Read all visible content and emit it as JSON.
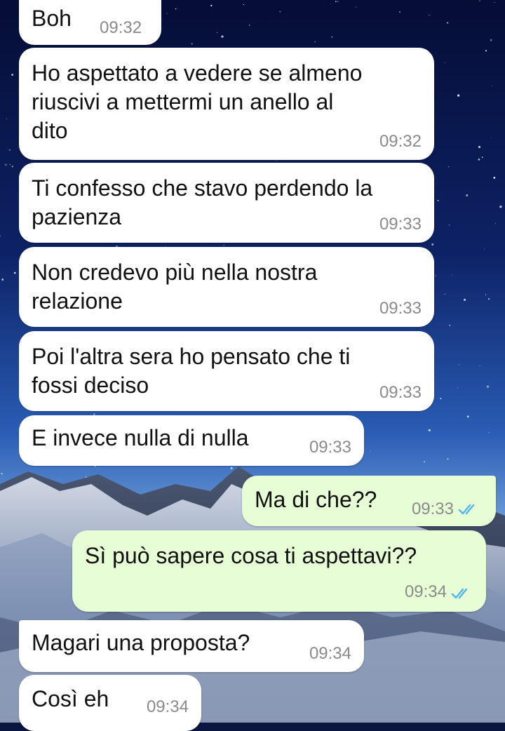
{
  "colors": {
    "incoming_bubble": "#ffffff",
    "outgoing_bubble": "#e7fdd6",
    "read_ticks": "#4fb6ec",
    "timestamp": "#8a8a8a"
  },
  "wallpaper": {
    "description_icon": "night-sky-mountains-wallpaper"
  },
  "messages": [
    {
      "direction": "incoming",
      "text": "Boh",
      "time": "09:32"
    },
    {
      "direction": "incoming",
      "text": "Ho aspettato a vedere se almeno\nriuscivi a mettermi un anello al\ndito",
      "time": "09:32"
    },
    {
      "direction": "incoming",
      "text": "Ti confesso che stavo perdendo la\npazienza",
      "time": "09:33"
    },
    {
      "direction": "incoming",
      "text": "Non credevo più nella nostra\nrelazione",
      "time": "09:33"
    },
    {
      "direction": "incoming",
      "text": "Poi l'altra sera ho pensato che ti\nfossi deciso",
      "time": "09:33"
    },
    {
      "direction": "incoming",
      "text": "E invece nulla di nulla",
      "time": "09:33"
    },
    {
      "direction": "outgoing",
      "text": "Ma di che??",
      "time": "09:33",
      "status": "read",
      "status_icon": "double-check-icon"
    },
    {
      "direction": "outgoing",
      "text": "Sì può sapere cosa ti aspettavi??",
      "time": "09:34",
      "status": "read",
      "status_icon": "double-check-icon"
    },
    {
      "direction": "incoming",
      "text": "Magari una proposta?",
      "time": "09:34"
    },
    {
      "direction": "incoming",
      "text": "Così eh",
      "time": "09:34"
    }
  ]
}
